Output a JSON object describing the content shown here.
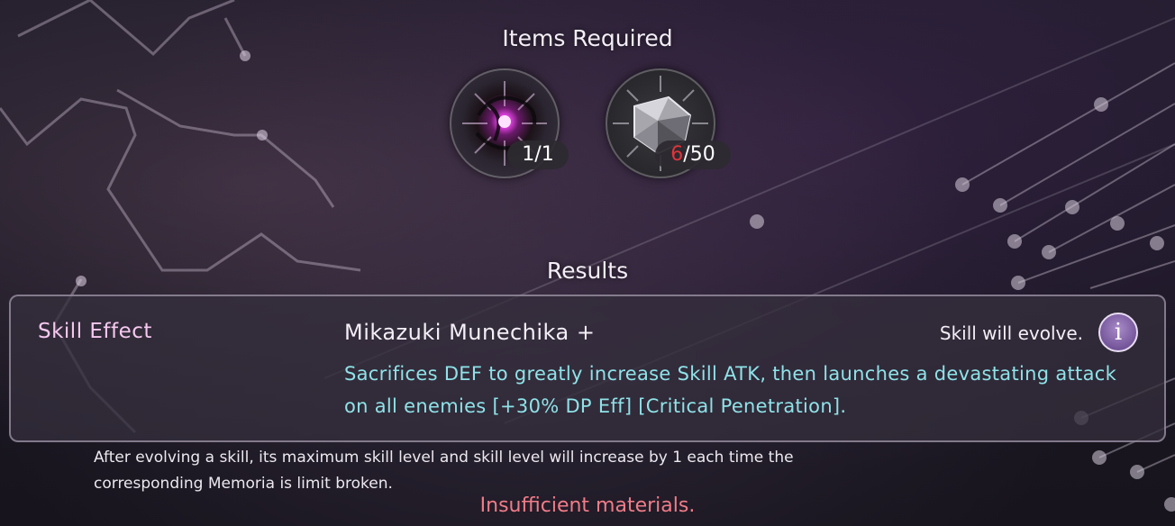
{
  "items_section": {
    "title": "Items Required",
    "items": [
      {
        "icon": "dark-orb-icon",
        "have": "1",
        "need": "/1"
      },
      {
        "icon": "crystal-icon",
        "have": "6",
        "need": "/50",
        "have_color": "#e0343a"
      }
    ]
  },
  "results_section": {
    "title": "Results",
    "label": "Skill Effect",
    "skill_name": "Mikazuki Munechika +",
    "evolve_text": "Skill will evolve.",
    "info_icon": "i",
    "description": "Sacrifices DEF to greatly increase Skill ATK, then launches a devastating attack on all enemies [+30% DP Eff] [Critical Penetration]."
  },
  "note": "After evolving a skill, its maximum skill level and skill level will increase by 1 each time the corresponding Memoria is limit broken.",
  "warning": "Insufficient materials.",
  "colors": {
    "label": "#f6c8ef",
    "description": "#8fe2e8",
    "warning": "#f07c88",
    "insufficient": "#e0343a"
  }
}
